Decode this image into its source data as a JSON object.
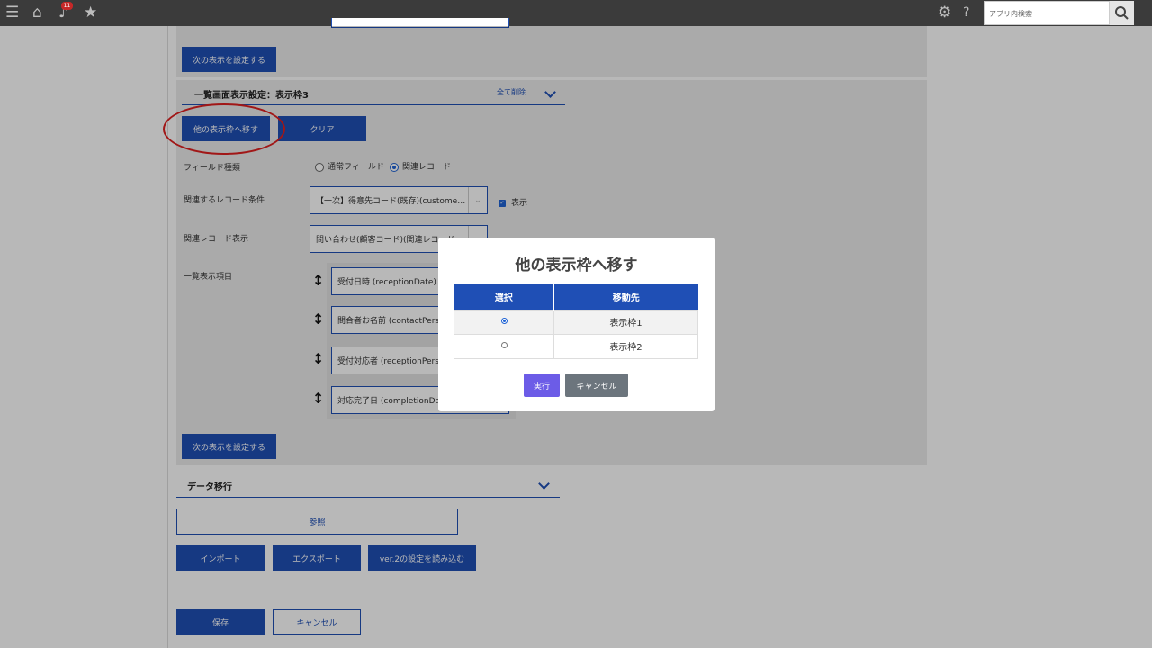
{
  "topbar": {
    "notification_count": "11",
    "search_placeholder": "アプリ内検索"
  },
  "section_prev": {
    "next_button": "次の表示を設定する"
  },
  "section3": {
    "title": "一覧画面表示設定：表示枠3",
    "clear_all": "全て削除",
    "move_button": "他の表示枠へ移す",
    "clear_button": "クリア",
    "field_type_label": "フィールド種類",
    "field_type_options": [
      "通常フィールド",
      "関連レコード"
    ],
    "related_condition_label": "関連するレコード条件",
    "related_condition_value": "【一次】得意先コード(既存)(custome…",
    "show_checkbox": "表示",
    "related_display_label": "関連レコード表示",
    "related_display_value": "問い合わせ(顧客コード)(関連レコード",
    "list_items_label": "一覧表示項目",
    "list_items": [
      "受付日時 (receptionDate)",
      "問合者お名前 (contactPerson)",
      "受付対応者 (receptionPerson)",
      "対応完了日 (completionDate)"
    ],
    "next_button": "次の表示を設定する"
  },
  "data_migration": {
    "title": "データ移行",
    "browse": "参照",
    "import": "インポート",
    "export": "エクスポート",
    "load_v2": "ver.2の設定を読み込む"
  },
  "footer": {
    "save": "保存",
    "cancel": "キャンセル"
  },
  "modal": {
    "title": "他の表示枠へ移す",
    "col_select": "選択",
    "col_destination": "移動先",
    "rows": [
      {
        "destination": "表示枠1",
        "selected": true
      },
      {
        "destination": "表示枠2",
        "selected": false
      }
    ],
    "exec": "実行",
    "cancel": "キャンセル"
  },
  "colors": {
    "primary": "#1f4fb5",
    "exec": "#6c5ce7",
    "cancel": "#6c757d",
    "annotation": "#e02020"
  }
}
